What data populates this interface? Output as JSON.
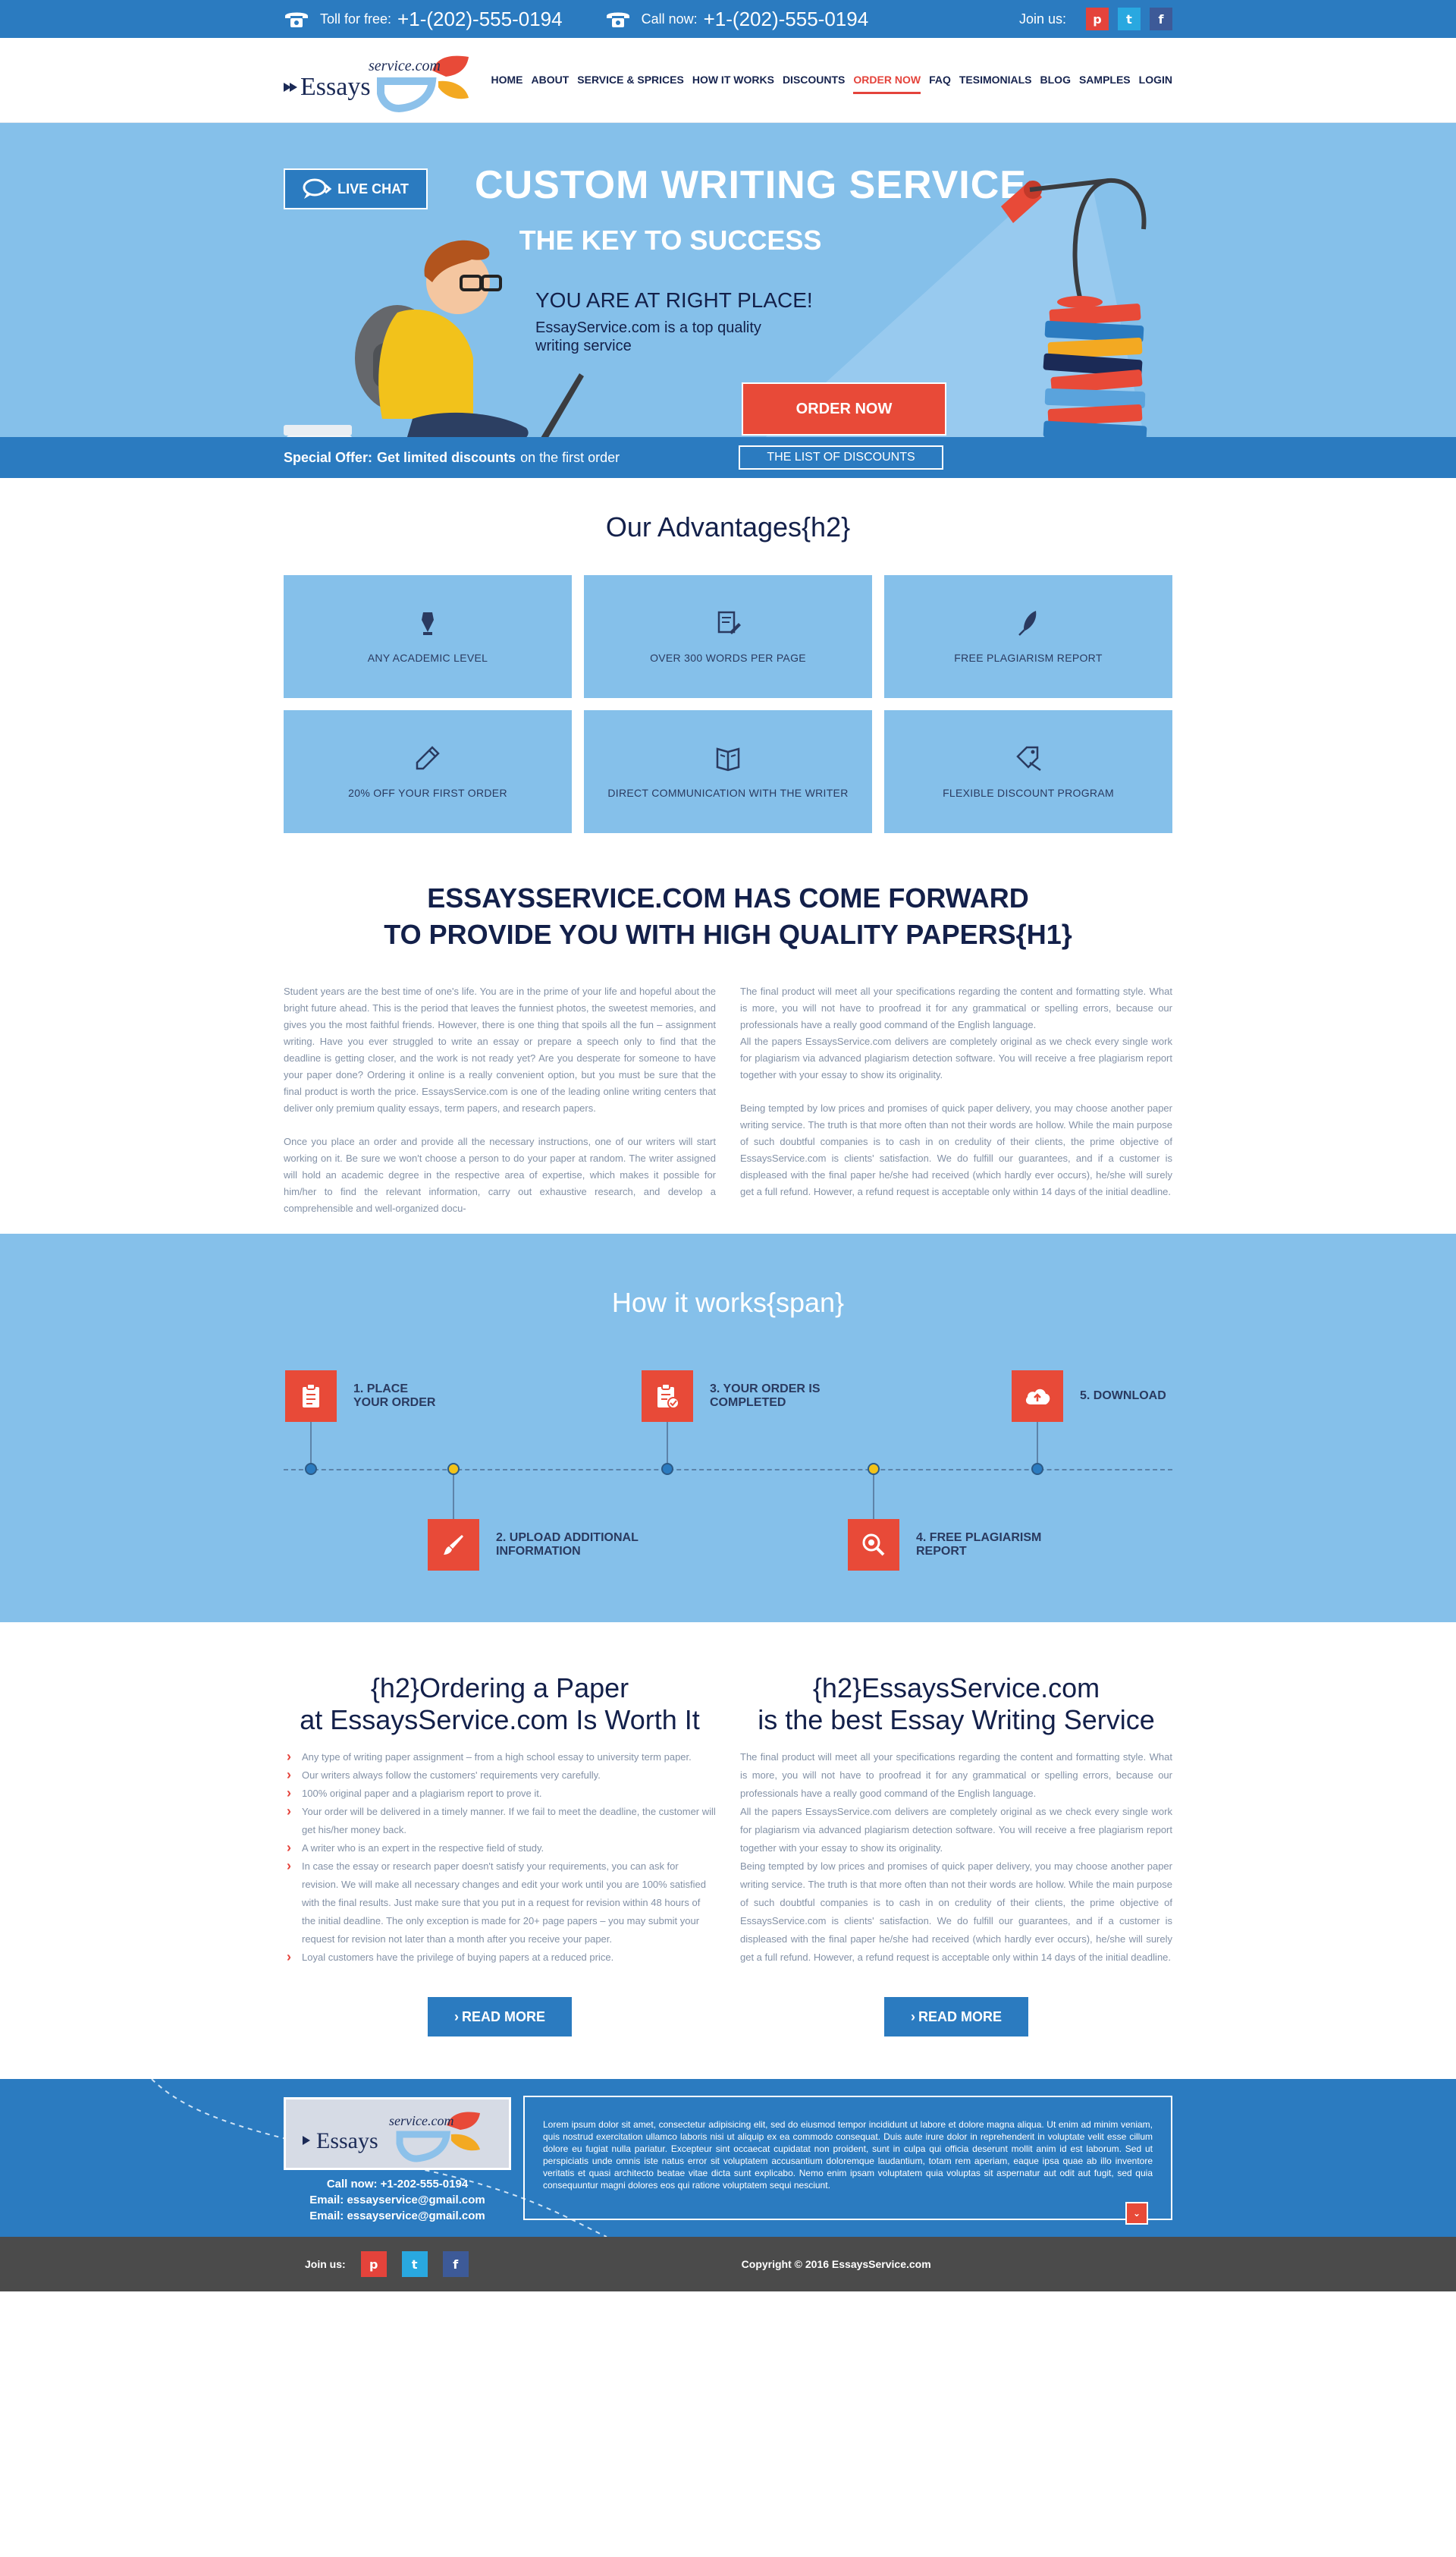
{
  "topbar": {
    "tollfree_label": "Toll for free:",
    "tollfree_number": "+1-(202)-555-0194",
    "callnow_label": "Call now:",
    "callnow_number": "+1-(202)-555-0194",
    "join_label": "Join us:",
    "social": [
      "p",
      "t",
      "f"
    ]
  },
  "logo": {
    "top": "service.com",
    "main": "Essays"
  },
  "nav": {
    "items": [
      "HOME",
      "ABOUT",
      "SERVICE & SPRICES",
      "HOW IT WORKS",
      "DISCOUNTS",
      "ORDER NOW",
      "FAQ",
      "TESIMONIALS",
      "BLOG",
      "SAMPLES",
      "LOGIN"
    ],
    "active": "ORDER NOW"
  },
  "hero": {
    "live_chat": "LIVE CHAT",
    "title": "CUSTOM WRITING SERVICE",
    "subtitle": "THE KEY TO SUCCESS",
    "heading": "YOU ARE AT RIGHT PLACE!",
    "text": "EssayService.com is a top quality writing service",
    "order_button": "ORDER NOW"
  },
  "offer": {
    "prefix": "Special Offer:",
    "bold": "Get limited discounts",
    "suffix": "on the first order",
    "button": "THE LIST OF DISCOUNTS"
  },
  "advantages": {
    "title": "Our Advantages{h2}",
    "items": [
      {
        "label": "ANY ACADEMIC LEVEL",
        "icon": "pen-nib-icon"
      },
      {
        "label": "OVER 300 WORDS PER PAGE",
        "icon": "document-edit-icon"
      },
      {
        "label": "FREE PLAGIARISM REPORT",
        "icon": "quill-icon"
      },
      {
        "label": "20% OFF YOUR FIRST ORDER",
        "icon": "pencil-icon"
      },
      {
        "label": "DIRECT COMMUNICATION WITH THE WRITER",
        "icon": "book-icon"
      },
      {
        "label": "FLEXIBLE DISCOUNT PROGRAM",
        "icon": "discount-tag-icon"
      }
    ]
  },
  "intro": {
    "title_line1": "ESSAYSSERVICE.COM HAS COME FORWARD",
    "title_line2": "TO PROVIDE YOU WITH HIGH QUALITY PAPERS{H1}",
    "left_p1": "Student years are the best time of one's life. You are in the prime of your life and hopeful about the bright future ahead. This is the period that leaves the funniest photos, the sweetest memories, and gives you the most faithful friends. However, there is one thing that spoils all the fun – assignment writing. Have you ever struggled to write an essay or prepare a speech only to find that the deadline is getting closer, and the work is not ready yet? Are you desperate for someone to have your paper done? Ordering it online is a really convenient option, but you must be sure that the final product is worth the price. EssaysService.com is one of the leading online writing centers that deliver only premium quality essays, term papers, and research papers.",
    "left_p2": "Once you place an order and provide all the necessary instructions, one of our writers will start working on it. Be sure we won't choose a person to do your paper at random. The writer assigned will hold an academic degree in the respective area of expertise, which makes it possible for him/her to find the relevant information, carry out exhaustive research, and develop a comprehensible and well-organized docu-",
    "right_p1": "The final product will meet all your specifications regarding the content and formatting style. What is more, you will not have to proofread it for any grammatical or spelling errors, because our professionals have a really good command of the English language.",
    "right_p2": "All the papers EssaysService.com delivers are completely original as we check every single work for plagiarism via advanced plagiarism detection software. You will receive a free plagiarism report together with your essay to show its originality.",
    "right_p3": "Being tempted by low prices and promises of quick paper delivery, you may choose another paper writing service. The truth is that more often than not their words are hollow. While the main purpose of such doubtful companies is to cash in on credulity of their clients, the prime objective of EssaysService.com is clients' satisfaction. We do fulfill our guarantees, and if a customer is displeased with the final paper he/she had received (which hardly ever occurs), he/she will surely get a full refund. However, a refund request is acceptable only within 14 days of the initial deadline."
  },
  "how": {
    "title": "How it works{span}",
    "steps": [
      {
        "line1": "1. PLACE",
        "line2": "YOUR ORDER",
        "icon": "clipboard-icon"
      },
      {
        "line1": "2. UPLOAD ADDITIONAL",
        "line2": "INFORMATION",
        "icon": "brush-icon"
      },
      {
        "line1": "3. YOUR ORDER IS",
        "line2": "COMPLETED",
        "icon": "clipboard-check-icon"
      },
      {
        "line1": "4. FREE PLAGIARISM",
        "line2": "REPORT",
        "icon": "search-icon"
      },
      {
        "line1": "5. DOWNLOAD",
        "line2": "",
        "icon": "cloud-upload-icon"
      }
    ]
  },
  "ordering": {
    "left_title_line1": "{h2}Ordering a Paper",
    "left_title_line2": "at EssaysService.com Is Worth It",
    "list": [
      "Any type of writing paper assignment – from a high school essay to university term paper.",
      "Our writers always follow the customers' requirements very carefully.",
      "100% original paper and a plagiarism report to prove it.",
      "Your order will be delivered in a timely manner. If we fail to meet the deadline, the customer will get his/her money back.",
      "A writer who is an expert in the respective field of study.",
      "In case the essay or research paper doesn't satisfy your requirements, you can ask for revision. We will make all necessary changes and edit your work until you are 100% satisfied with the final results. Just make sure that you put in a request for revision within 48 hours of the initial deadline. The only exception is made for 20+ page papers – you may submit your request for revision not later than a month after you receive your paper.",
      "Loyal customers have the privilege of buying papers at a reduced price."
    ],
    "right_title_line1": "{h2}EssaysService.com",
    "right_title_line2": "is the best Essay Writing Service",
    "right_p1": "The final product will meet all your specifications regarding the content and formatting style. What is more, you will not have to proofread it for any grammatical or spelling errors, because our professionals have a really good command of the English language.",
    "right_p2": "All the papers EssaysService.com delivers are completely original as we check every single work for plagiarism via advanced plagiarism detection software. You will receive a free plagiarism report together with your essay to show its originality.",
    "right_p3": "Being tempted by low prices and promises of quick paper delivery, you may choose another paper writing service. The truth is that more often than not their words are hollow. While the main purpose of such doubtful companies is to cash in on credulity of their clients, the prime objective of EssaysService.com is clients' satisfaction. We do fulfill our guarantees, and if a customer is displeased with the final paper he/she had received (which hardly ever occurs), he/she will surely get a full refund. However, a refund request is acceptable only within 14 days of the initial deadline.",
    "read_more": "READ MORE"
  },
  "footer": {
    "call": "Call now: +1-202-555-0194",
    "email1": "Email: essayservice@gmail.com",
    "email2": "Email: essayservice@gmail.com",
    "lorem": "Lorem ipsum dolor sit amet, consectetur adipisicing elit, sed do eiusmod tempor incididunt ut labore et dolore magna aliqua. Ut enim ad minim veniam, quis nostrud exercitation ullamco laboris nisi ut aliquip ex ea commodo consequat. Duis aute irure dolor in reprehenderit in voluptate velit esse cillum dolore eu fugiat nulla pariatur. Excepteur sint occaecat cupidatat non proident, sunt in culpa qui officia deserunt mollit anim id est laborum. Sed ut perspiciatis unde omnis iste natus error sit voluptatem accusantium doloremque laudantium, totam rem aperiam, eaque ipsa quae ab illo inventore veritatis et quasi architecto beatae vitae dicta sunt explicabo. Nemo enim ipsam voluptatem quia voluptas sit aspernatur aut odit aut fugit, sed quia consequuntur magni dolores eos qui ratione voluptatem sequi nesciunt.",
    "join_label": "Join us:",
    "copyright": "Copyright © 2016 EssaysService.com"
  },
  "colors": {
    "primary_blue": "#2b7bc0",
    "light_blue": "#85c0ea",
    "accent_red": "#e84a38",
    "navy": "#13204a",
    "footer_gray": "#4b4b4b"
  }
}
